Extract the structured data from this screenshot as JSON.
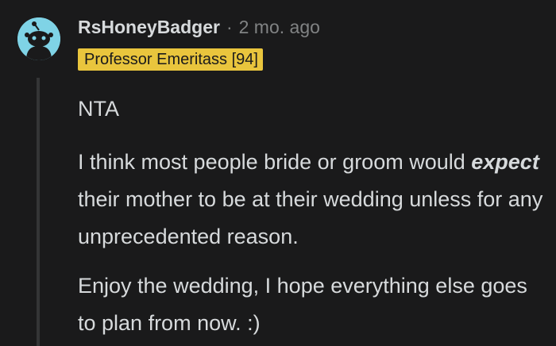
{
  "comment": {
    "author": "RsHoneyBadger",
    "separator": "·",
    "timestamp": "2 mo. ago",
    "flair": "Professor Emeritass [94]",
    "avatar_icon": "reddit-snoo-avatar-icon",
    "paragraphs": {
      "p0": "NTA",
      "p1_before": "I think most people bride or groom would ",
      "p1_emphasis": "expect",
      "p1_after": " their mother to be at their wedding unless for any unprecedented reason.",
      "p2": "Enjoy the wedding, I hope everything else goes to plan from now. :)"
    }
  },
  "colors": {
    "background": "#1a1a1b",
    "text": "#d7dadc",
    "meta": "#818384",
    "flair_bg": "#e9c53d",
    "avatar_bg": "#7fd3e6",
    "thread_line": "#343536"
  }
}
